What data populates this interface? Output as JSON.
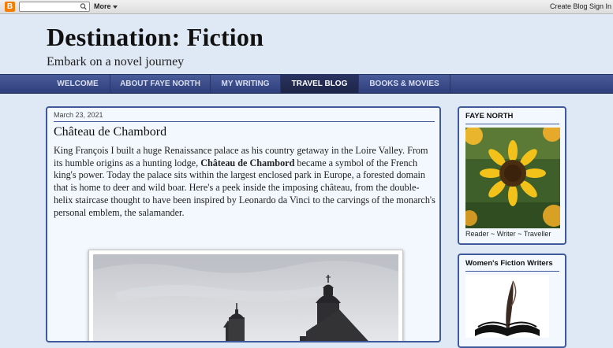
{
  "navbar": {
    "logo_letter": "B",
    "more_label": "More",
    "create_blog_label": "Create Blog",
    "sign_in_label": "Sign In"
  },
  "header": {
    "title": "Destination: Fiction",
    "description": "Embark on a novel journey"
  },
  "tabs": [
    {
      "label": "WELCOME",
      "active": false
    },
    {
      "label": "ABOUT FAYE NORTH",
      "active": false
    },
    {
      "label": "MY WRITING",
      "active": false
    },
    {
      "label": "TRAVEL BLOG",
      "active": true
    },
    {
      "label": "BOOKS & MOVIES",
      "active": false
    }
  ],
  "post": {
    "date": "March 23, 2021",
    "title": "Château de Chambord",
    "body_before": "King François I built a huge Renaissance palace as his country getaway in the Loire Valley. From its humble origins as a hunting lodge, ",
    "body_bold": "Château de Chambord",
    "body_after": " became a symbol of the French king's power. Today the palace sits within the largest enclosed park in Europe, a forested domain that is home to deer and wild boar. Here's a peek inside the imposing château, from the double-helix staircase thought to have been inspired by Leonardo da Vinci to the carvings of the monarch's personal emblem, the salamander."
  },
  "sidebar": {
    "profile": {
      "title": "FAYE NORTH",
      "caption": "Reader ~ Writer ~ Traveller"
    },
    "wfw": {
      "title": "Women's Fiction Writers"
    }
  },
  "colors": {
    "page_bg": "#dfe9f5",
    "accent": "#3f5a9a",
    "tab_bar": "#34457f",
    "blogger_orange": "#f57d00"
  }
}
